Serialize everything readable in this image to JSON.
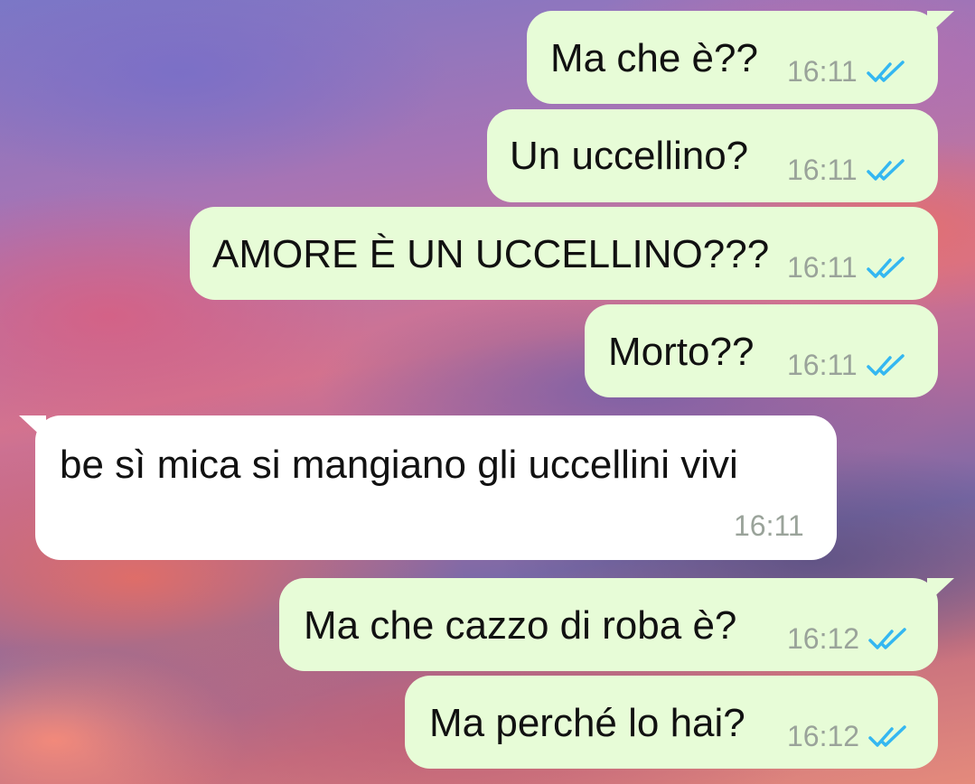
{
  "chat": {
    "messages": [
      {
        "direction": "out",
        "text": "Ma che è??",
        "time": "16:11",
        "status": "read"
      },
      {
        "direction": "out",
        "text": "Un uccellino?",
        "time": "16:11",
        "status": "read"
      },
      {
        "direction": "out",
        "text": "AMORE È UN UCCELLINO???",
        "time": "16:11",
        "status": "read"
      },
      {
        "direction": "out",
        "text": "Morto??",
        "time": "16:11",
        "status": "read"
      },
      {
        "direction": "in",
        "text": "be sì mica si mangiano gli uccellini vivi",
        "time": "16:11"
      },
      {
        "direction": "out",
        "text": "Ma che cazzo di roba è?",
        "time": "16:12",
        "status": "read"
      },
      {
        "direction": "out",
        "text": "Ma perché lo hai?",
        "time": "16:12",
        "status": "read"
      }
    ]
  },
  "colors": {
    "outgoing_bubble": "#e7fcd7",
    "incoming_bubble": "#ffffff",
    "read_ticks": "#34b7f1",
    "timestamp": "#9aa39a"
  },
  "icons": {
    "read_status": "double-check-icon"
  }
}
